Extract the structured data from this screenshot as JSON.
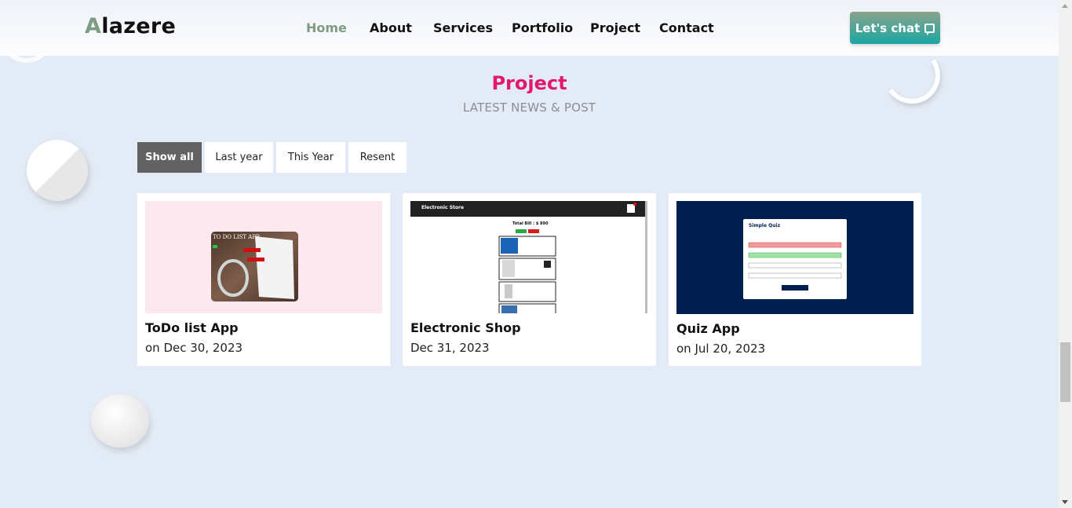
{
  "header": {
    "logo_first": "A",
    "logo_rest": "lazere",
    "nav": [
      "Home",
      "About",
      "Services",
      "Portfolio",
      "Project",
      "Contact"
    ],
    "chat_label": "Let's chat",
    "chat_icon": "chat-icon"
  },
  "section": {
    "title": "Project",
    "subtitle": "LATEST NEWS & POST"
  },
  "filters": [
    "Show all",
    "Last year",
    "This Year",
    "Resent"
  ],
  "projects": [
    {
      "title": "ToDo list App",
      "date": "on Dec 30, 2023",
      "thumb_text": "TO DO LIST APP"
    },
    {
      "title": "Electronic Shop",
      "date": "Dec 31, 2023",
      "thumb_header": "Electronic Store",
      "thumb_total": "Total Bill : $ 890"
    },
    {
      "title": "Quiz App",
      "date": "on Jul 20, 2023",
      "thumb_heading": "Simple Quiz"
    }
  ],
  "colors": {
    "accent": "#e2186f",
    "logo_accent": "#7e9c82",
    "background": "#e3ebf6",
    "active_filter": "#626262"
  }
}
